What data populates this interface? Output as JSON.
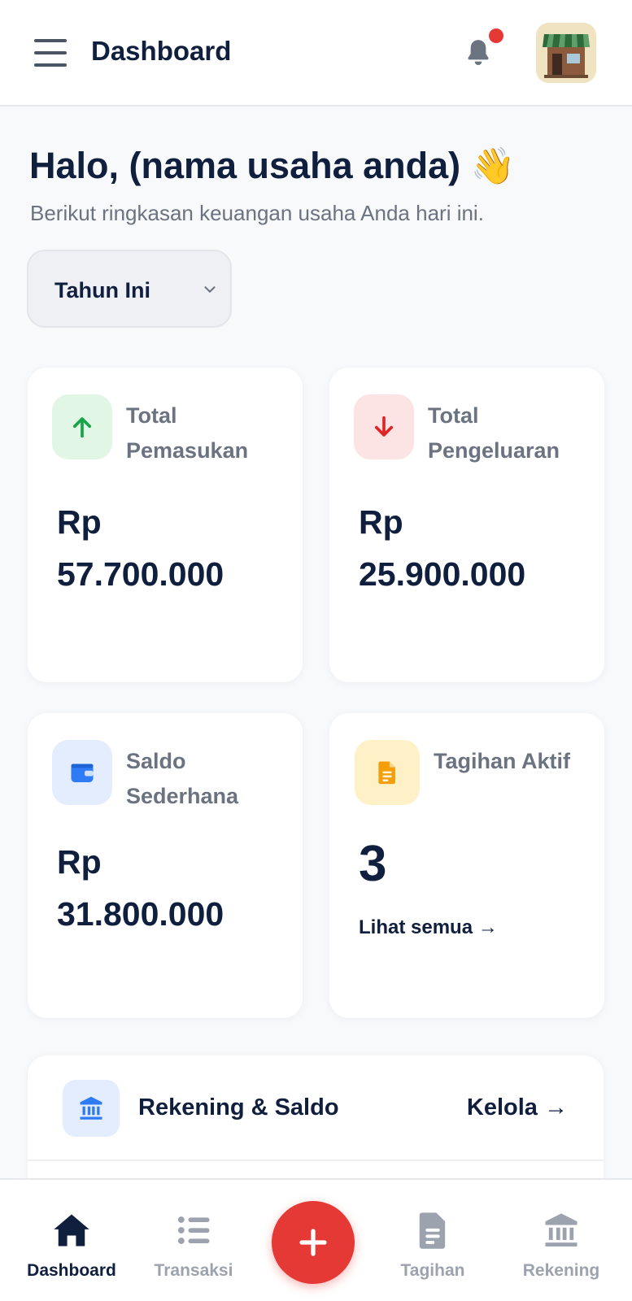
{
  "header": {
    "title": "Dashboard",
    "menu_icon": "menu-icon",
    "notification_icon": "bell-icon",
    "avatar_icon": "store-icon"
  },
  "greeting": {
    "title": "Halo, (nama usaha anda)",
    "emoji": "👋",
    "subtitle": "Berikut ringkasan keuangan usaha Anda hari ini."
  },
  "period_select": {
    "value": "Tahun Ini"
  },
  "cards": {
    "income": {
      "label": "Total Pemasukan",
      "currency": "Rp",
      "value": "57.700.000",
      "icon": "arrow-up-icon",
      "accent": "#16a34a"
    },
    "expense": {
      "label": "Total Pengeluaran",
      "currency": "Rp",
      "value": "25.900.000",
      "icon": "arrow-down-icon",
      "accent": "#dc2626"
    },
    "balance": {
      "label": "Saldo Sederhana",
      "currency": "Rp",
      "value": "31.800.000",
      "icon": "wallet-icon",
      "accent": "#2563eb"
    },
    "bills": {
      "label": "Tagihan Aktif",
      "count": "3",
      "link": "Lihat semua →",
      "icon": "document-icon",
      "accent": "#f59e0b"
    }
  },
  "accounts_panel": {
    "title": "Rekening & Saldo",
    "link": "Kelola →",
    "icon": "bank-icon"
  },
  "bottom_nav": {
    "items": [
      {
        "label": "Dashboard",
        "icon": "home-icon",
        "active": true
      },
      {
        "label": "Transaksi",
        "icon": "list-icon",
        "active": false
      },
      {
        "label": "Tagihan",
        "icon": "document-icon",
        "active": false
      },
      {
        "label": "Rekening",
        "icon": "bank-icon",
        "active": false
      }
    ],
    "fab_icon": "plus-icon",
    "fab_color": "#e53935"
  }
}
